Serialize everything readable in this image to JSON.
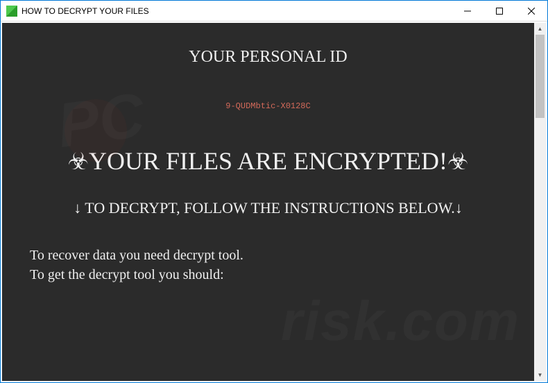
{
  "window": {
    "title": "HOW TO DECRYPT YOUR FILES"
  },
  "content": {
    "heading_personal": "YOUR PERSONAL ID",
    "personal_id": "9-QUDMbtic-X0128C",
    "biohazard_symbol": "☣",
    "warning_line": "YOUR FILES ARE ENCRYPTED!",
    "down_arrow": "↓",
    "instructions_heading": " TO DECRYPT, FOLLOW THE INSTRUCTIONS BELOW.",
    "body_line1": "To recover data you need decrypt tool.",
    "body_line2": "To get the decrypt tool you should:"
  },
  "watermark": {
    "text1": "PC",
    "text2": "risk.com"
  }
}
